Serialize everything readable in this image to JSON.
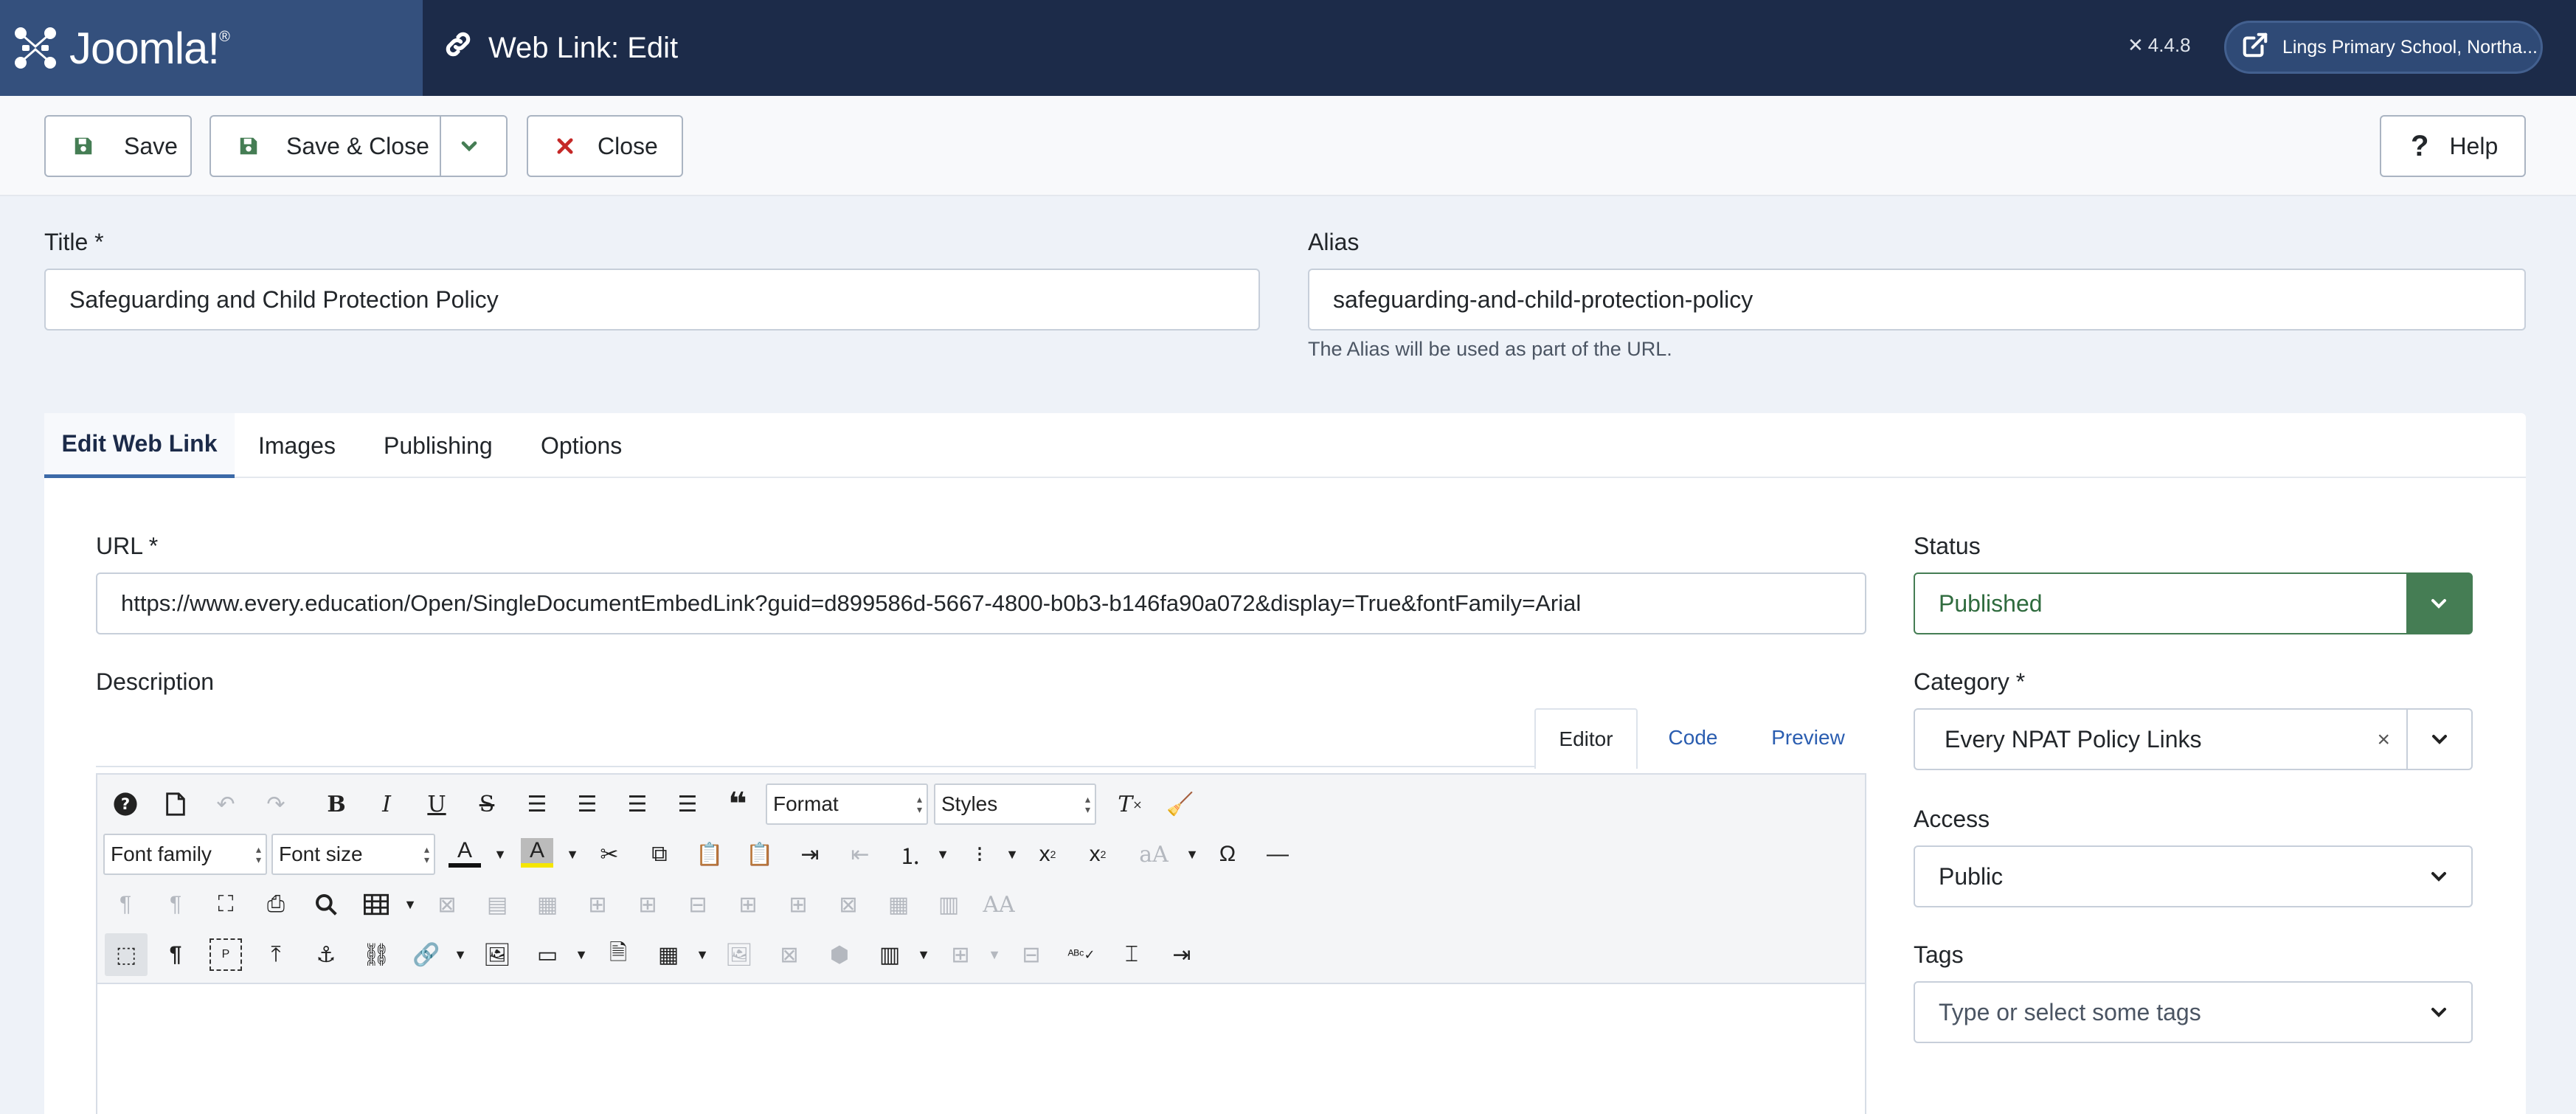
{
  "header": {
    "logo_text": "Joomla!",
    "page_title": "Web Link: Edit",
    "version": "4.4.8",
    "site_name": "Lings Primary School, Northa..."
  },
  "toolbar": {
    "save_label": "Save",
    "save_close_label": "Save & Close",
    "close_label": "Close",
    "help_label": "Help"
  },
  "form": {
    "title_label": "Title *",
    "title_value": "Safeguarding and Child Protection Policy",
    "alias_label": "Alias",
    "alias_value": "safeguarding-and-child-protection-policy",
    "alias_hint": "The Alias will be used as part of the URL."
  },
  "tabs": [
    {
      "label": "Edit Web Link",
      "active": true
    },
    {
      "label": "Images",
      "active": false
    },
    {
      "label": "Publishing",
      "active": false
    },
    {
      "label": "Options",
      "active": false
    }
  ],
  "main": {
    "url_label": "URL *",
    "url_value": "https://www.every.education/Open/SingleDocumentEmbedLink?guid=d899586d-5667-4800-b0b3-b146fa90a072&display=True&fontFamily=Arial",
    "description_label": "Description",
    "editor_tabs": [
      {
        "label": "Editor",
        "active": true
      },
      {
        "label": "Code",
        "active": false
      },
      {
        "label": "Preview",
        "active": false
      }
    ],
    "format_select": "Format",
    "styles_select": "Styles",
    "font_family_select": "Font family",
    "font_size_select": "Font size"
  },
  "sidebar": {
    "status_label": "Status",
    "status_value": "Published",
    "category_label": "Category *",
    "category_value": "Every NPAT Policy Links",
    "category_clear": "×",
    "access_label": "Access",
    "access_value": "Public",
    "tags_label": "Tags",
    "tags_placeholder": "Type or select some tags"
  },
  "colors": {
    "header_bg": "#1c2b49",
    "logo_bg": "#34507d",
    "status_green": "#457d54",
    "link_blue": "#2a5db0",
    "close_red": "#c52827"
  }
}
